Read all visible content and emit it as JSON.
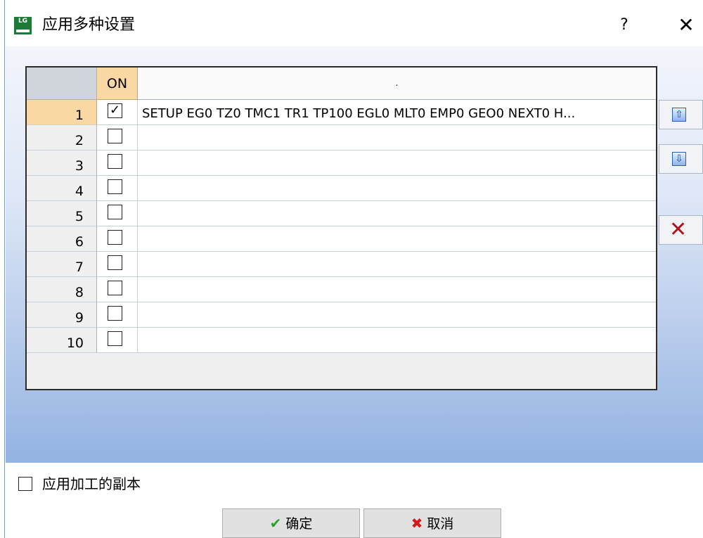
{
  "window": {
    "title": "应用多种设置",
    "help_label": "?",
    "close_label": "✕"
  },
  "grid": {
    "header": {
      "on": "ON",
      "description": "."
    },
    "rows": [
      {
        "num": "1",
        "checked": true,
        "description": "SETUP EG0 TZ0 TMC1 TR1 TP100 EGL0 MLT0 EMP0 GEO0 NEXT0 H..."
      },
      {
        "num": "2",
        "checked": false,
        "description": ""
      },
      {
        "num": "3",
        "checked": false,
        "description": ""
      },
      {
        "num": "4",
        "checked": false,
        "description": ""
      },
      {
        "num": "5",
        "checked": false,
        "description": ""
      },
      {
        "num": "6",
        "checked": false,
        "description": ""
      },
      {
        "num": "7",
        "checked": false,
        "description": ""
      },
      {
        "num": "8",
        "checked": false,
        "description": ""
      },
      {
        "num": "9",
        "checked": false,
        "description": ""
      },
      {
        "num": "10",
        "checked": false,
        "description": ""
      }
    ],
    "selected_row": "1"
  },
  "side_buttons": {
    "move_up_icon": "arrow-up-icon",
    "move_down_icon": "arrow-down-icon",
    "delete_icon": "delete-x-icon"
  },
  "options": {
    "apply_copies_label": "应用加工的副本",
    "apply_copies_checked": false
  },
  "footer": {
    "ok_label": "确定",
    "cancel_label": "取消"
  }
}
